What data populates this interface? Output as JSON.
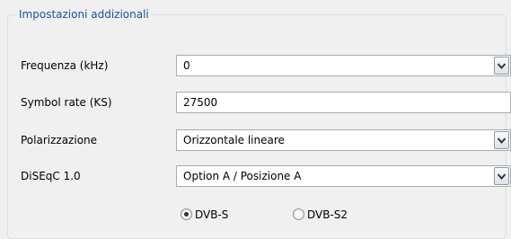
{
  "group": {
    "title": "Impostazioni addizionali"
  },
  "fields": {
    "frequency": {
      "label": "Frequenza (kHz)",
      "value": "0"
    },
    "symbol_rate": {
      "label": "Symbol rate (KS)",
      "value": "27500"
    },
    "polarization": {
      "label": "Polarizzazione",
      "value": "Orizzontale lineare"
    },
    "diseqc": {
      "label": "DiSEqC 1.0",
      "value": "Option A / Posizione A"
    }
  },
  "standard": {
    "options": [
      {
        "label": "DVB-S",
        "selected": true
      },
      {
        "label": "DVB-S2",
        "selected": false
      }
    ]
  },
  "icons": {
    "dropdown": "chevron-down-icon"
  },
  "colors": {
    "group_title": "#1e50a0",
    "field_border": "#a6acb3",
    "background": "#f0f0f0"
  }
}
